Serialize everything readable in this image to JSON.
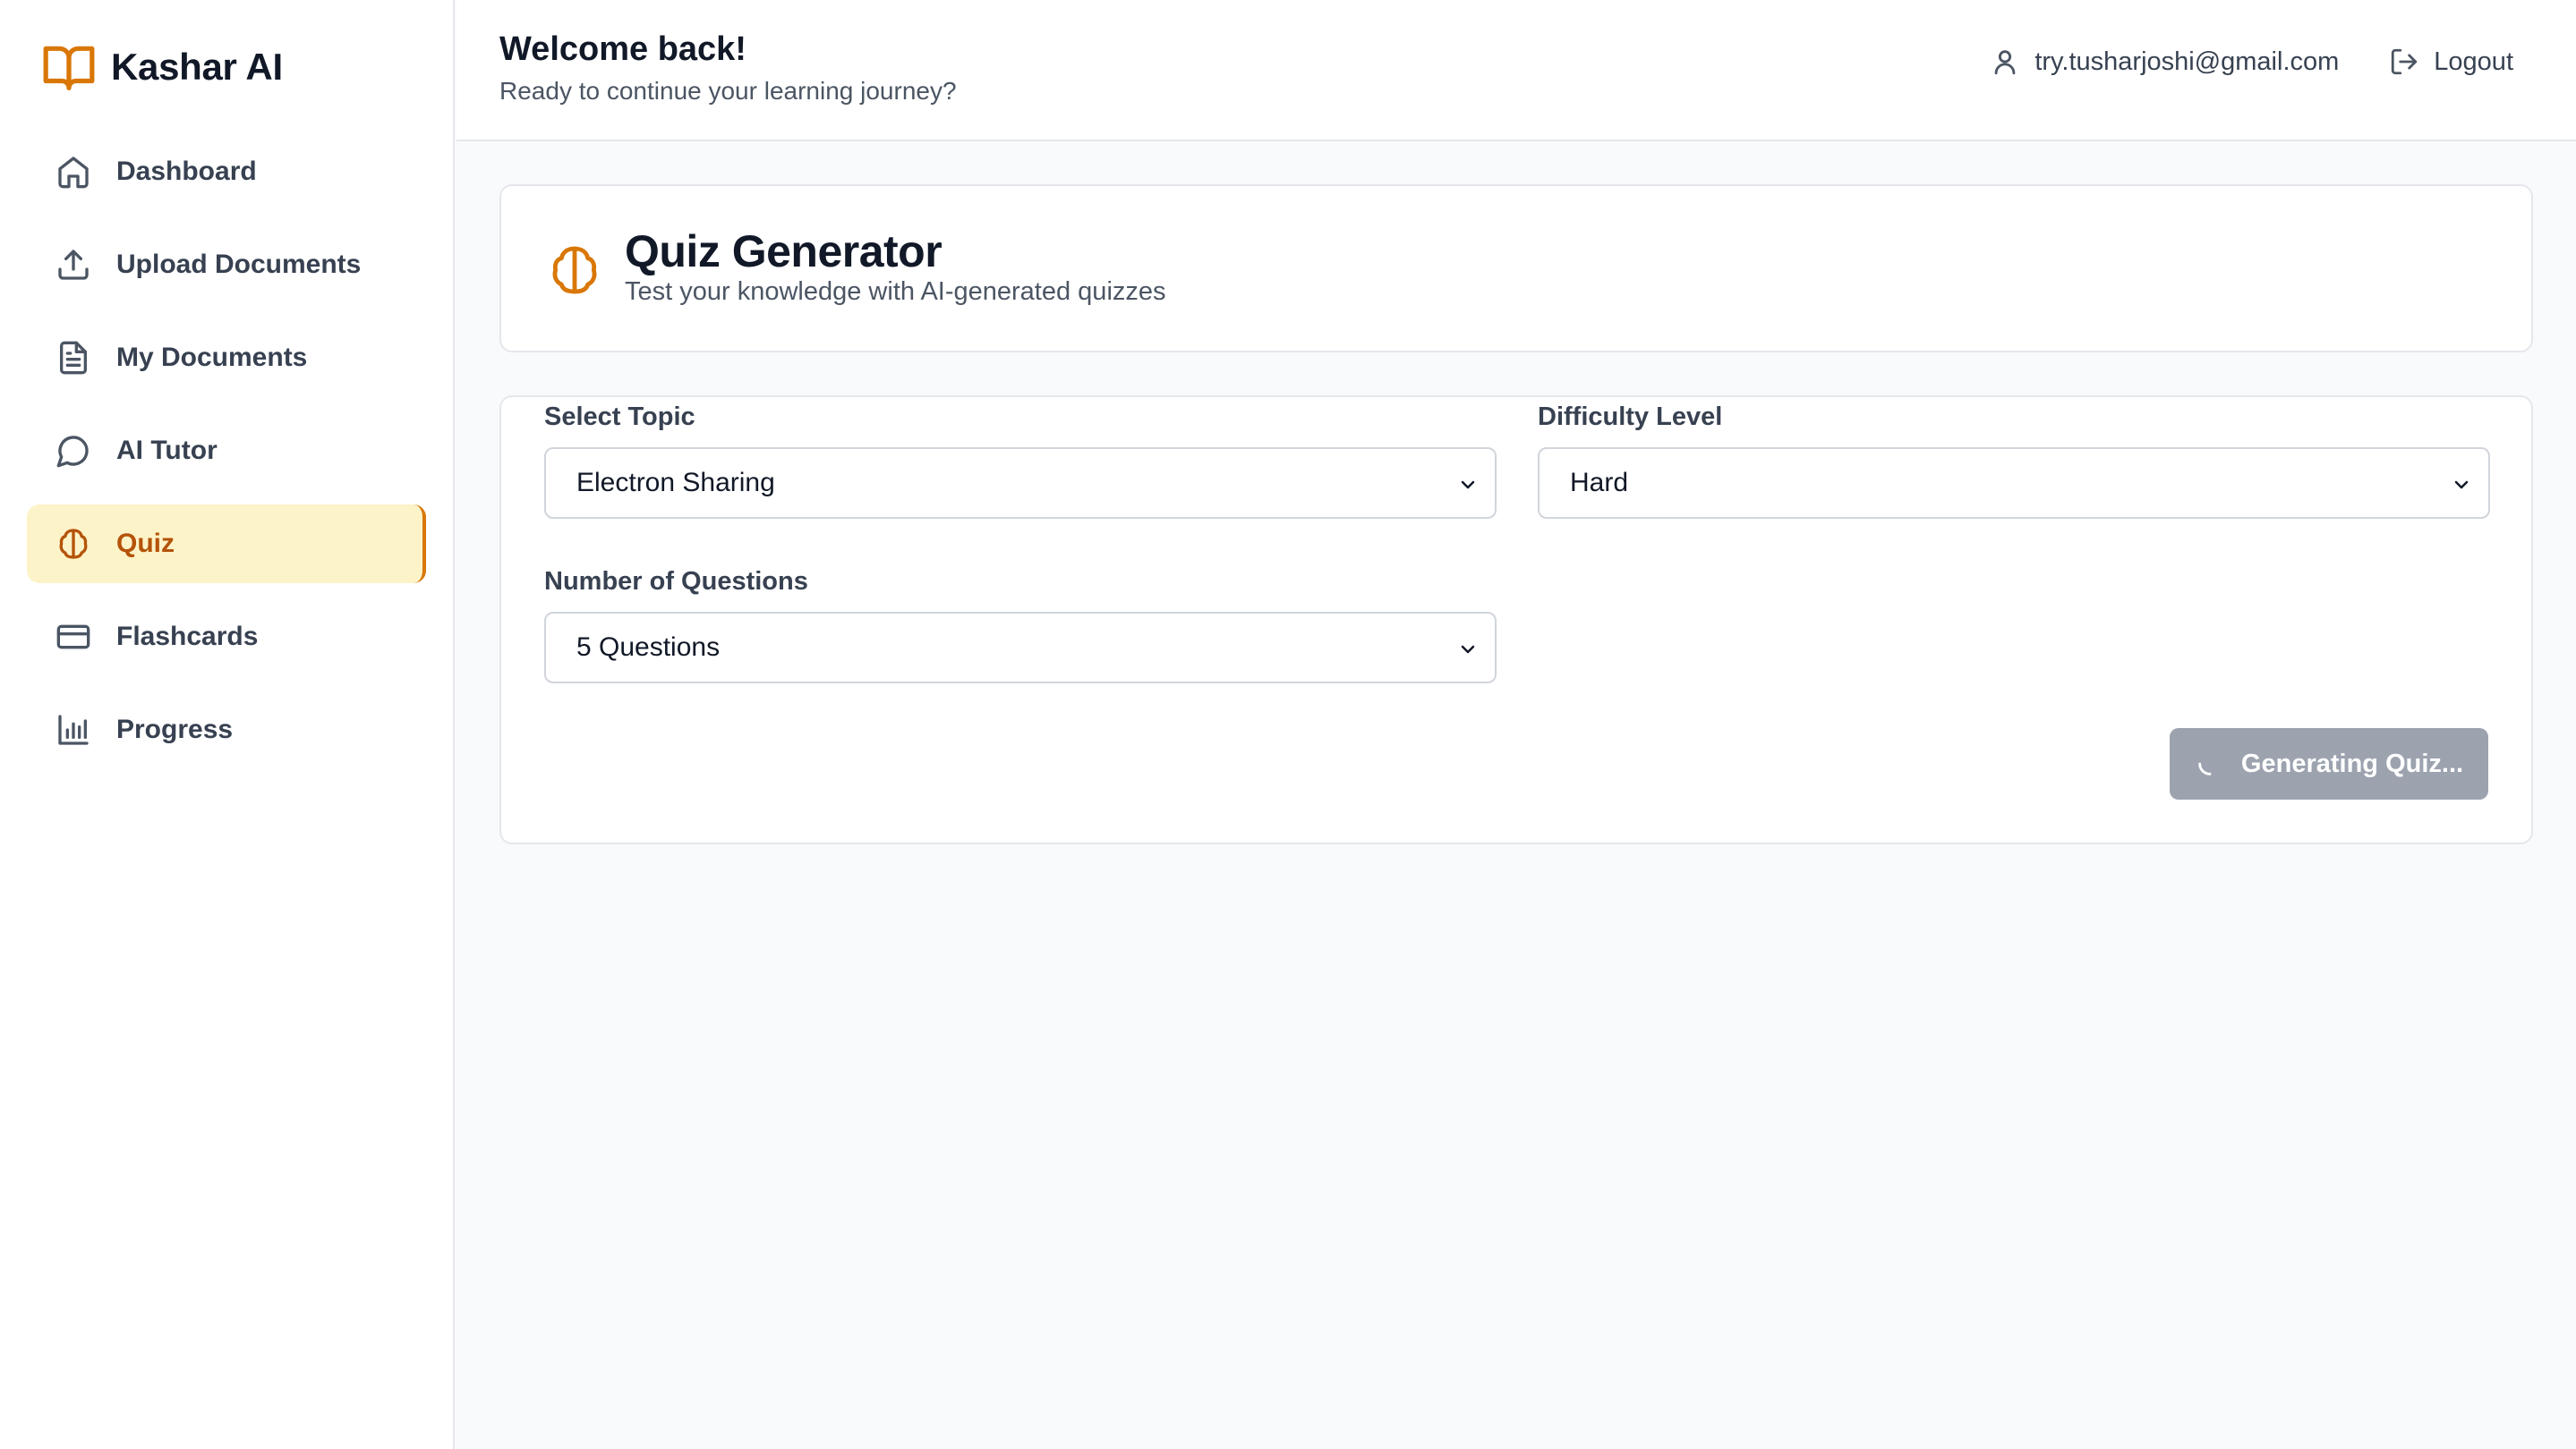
{
  "brand": {
    "name": "Kashar AI",
    "icon": "book-open-icon",
    "accent": "#d97706"
  },
  "sidebar": {
    "items": [
      {
        "label": "Dashboard",
        "icon": "home-icon",
        "active": false
      },
      {
        "label": "Upload Documents",
        "icon": "upload-icon",
        "active": false
      },
      {
        "label": "My Documents",
        "icon": "file-text-icon",
        "active": false
      },
      {
        "label": "AI Tutor",
        "icon": "message-circle-icon",
        "active": false
      },
      {
        "label": "Quiz",
        "icon": "brain-icon",
        "active": true
      },
      {
        "label": "Flashcards",
        "icon": "credit-card-icon",
        "active": false
      },
      {
        "label": "Progress",
        "icon": "bar-chart-icon",
        "active": false
      }
    ],
    "active_bg": "#fdf3c8",
    "active_color": "#b45309"
  },
  "header": {
    "welcome": "Welcome back!",
    "subtitle": "Ready to continue your learning journey?",
    "user_email": "try.tusharjoshi@gmail.com",
    "logout_label": "Logout"
  },
  "quiz": {
    "title": "Quiz Generator",
    "subtitle": "Test your knowledge with AI-generated quizzes",
    "topic_label": "Select Topic",
    "topic_value": "Electron Sharing",
    "difficulty_label": "Difficulty Level",
    "difficulty_value": "Hard",
    "count_label": "Number of Questions",
    "count_value": "5 Questions",
    "generate_label": "Generating Quiz...",
    "generate_disabled": true,
    "button_color": "#9ca3af"
  }
}
